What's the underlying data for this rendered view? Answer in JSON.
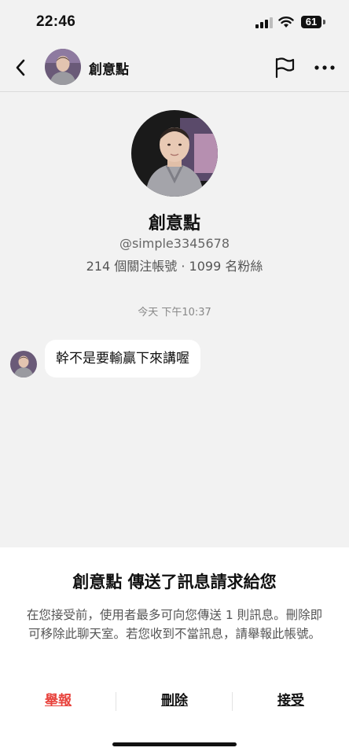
{
  "status_bar": {
    "time": "22:46",
    "battery": "61"
  },
  "header": {
    "title": "創意點"
  },
  "profile": {
    "name": "創意點",
    "handle": "@simple3345678",
    "stats": "214 個關注帳號 · 1099 名粉絲"
  },
  "chat": {
    "timestamp": "今天 下午10:37",
    "messages": [
      {
        "text": "幹不是要輸贏下來講喔"
      }
    ]
  },
  "request_sheet": {
    "title": "創意點 傳送了訊息請求給您",
    "description": "在您接受前，使用者最多可向您傳送 1 則訊息。刪除即可移除此聊天室。若您收到不當訊息，請舉報此帳號。",
    "actions": {
      "report": "舉報",
      "delete": "刪除",
      "accept": "接受"
    }
  },
  "colors": {
    "report_red": "#e8423c",
    "background": "#f2f2f2"
  },
  "icons": [
    "signal-icon",
    "wifi-icon",
    "back-arrow-icon",
    "flag-icon",
    "more-icon"
  ]
}
